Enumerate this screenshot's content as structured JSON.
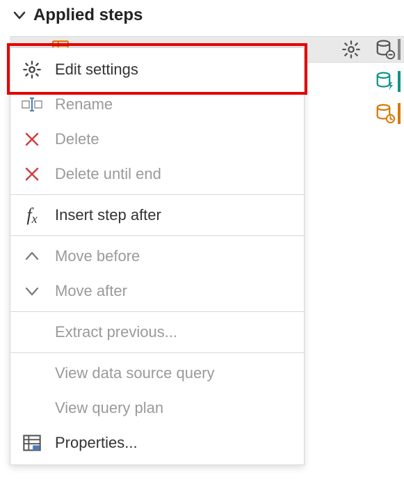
{
  "header": {
    "title": "Applied steps"
  },
  "menu": {
    "edit_settings": "Edit settings",
    "rename": "Rename",
    "delete": "Delete",
    "delete_until_end": "Delete until end",
    "insert_step_after": "Insert step after",
    "move_before": "Move before",
    "move_after": "Move after",
    "extract_previous": "Extract previous...",
    "view_data_source_query": "View data source query",
    "view_query_plan": "View query plan",
    "properties": "Properties..."
  },
  "colors": {
    "highlight": "#e60000",
    "disabled": "#9a9a9a",
    "teal": "#0d9488",
    "orange": "#d97706"
  }
}
